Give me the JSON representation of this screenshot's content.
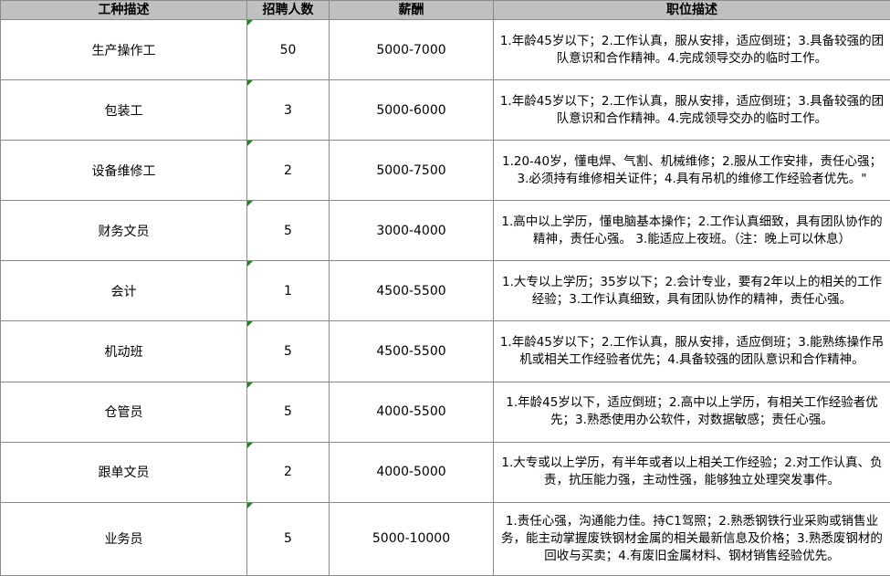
{
  "headers": [
    "工种描述",
    "招聘人数",
    "薪酬",
    "职位描述"
  ],
  "rows": [
    {
      "job": "生产操作工",
      "count": "50",
      "salary": "5000-7000",
      "desc": "1.年龄45岁以下；2.工作认真，服从安排，适应倒班；3.具备较强的团队意识和合作精神。4.完成领导交办的临时工作。"
    },
    {
      "job": "包装工",
      "count": "3",
      "salary": "5000-6000",
      "desc": "1.年龄45岁以下；2.工作认真，服从安排，适应倒班；3.具备较强的团队意识和合作精神。4.完成领导交办的临时工作。"
    },
    {
      "job": "设备维修工",
      "count": "2",
      "salary": "5000-7500",
      "desc": "1.20-40岁，懂电焊、气割、机械维修；2.服从工作安排，责任心强；3.必须持有维修相关证件；4.具有吊机的维修工作经验者优先。\""
    },
    {
      "job": "财务文员",
      "count": "5",
      "salary": "3000-4000",
      "desc": "1.高中以上学历，懂电脑基本操作；2.工作认真细致，具有团队协作的精神，责任心强。 3.能适应上夜班。（注：晚上可以休息）"
    },
    {
      "job": "会计",
      "count": "1",
      "salary": "4500-5500",
      "desc": "1.大专以上学历；35岁以下；2.会计专业，要有2年以上的相关的工作经验；3.工作认真细致，具有团队协作的精神，责任心强。"
    },
    {
      "job": "机动班",
      "count": "5",
      "salary": "4500-5500",
      "desc": "1.年龄45岁以下；2.工作认真，服从安排，适应倒班；3.能熟练操作吊机或相关工作经验者优先；4.具备较强的团队意识和合作精神。"
    },
    {
      "job": "仓管员",
      "count": "5",
      "salary": "4000-5500",
      "desc": "1.年龄45岁以下，适应倒班；2.高中以上学历，有相关工作经验者优先；3.熟悉使用办公软件，对数据敏感；责任心强。"
    },
    {
      "job": "跟单文员",
      "count": "2",
      "salary": "4000-5000",
      "desc": "1.大专或以上学历，有半年或者以上相关工作经验；2.对工作认真、负责，抗压能力强，主动性强，能够独立处理突发事件。"
    },
    {
      "job": "业务员",
      "count": "5",
      "salary": "5000-10000",
      "desc": "1.责任心强，沟通能力佳。持C1驾照；2.熟悉钢铁行业采购或销售业务，能主动掌握废铁钢材金属的相关最新信息及价格；3.熟悉废钢材的回收与买卖；4.有废旧金属材料、钢材销售经验优先。"
    }
  ],
  "colors": {
    "header_bg": "#c0c0c0",
    "grid": "#8a8a8a",
    "comment_marker": "#1e8a1e"
  }
}
